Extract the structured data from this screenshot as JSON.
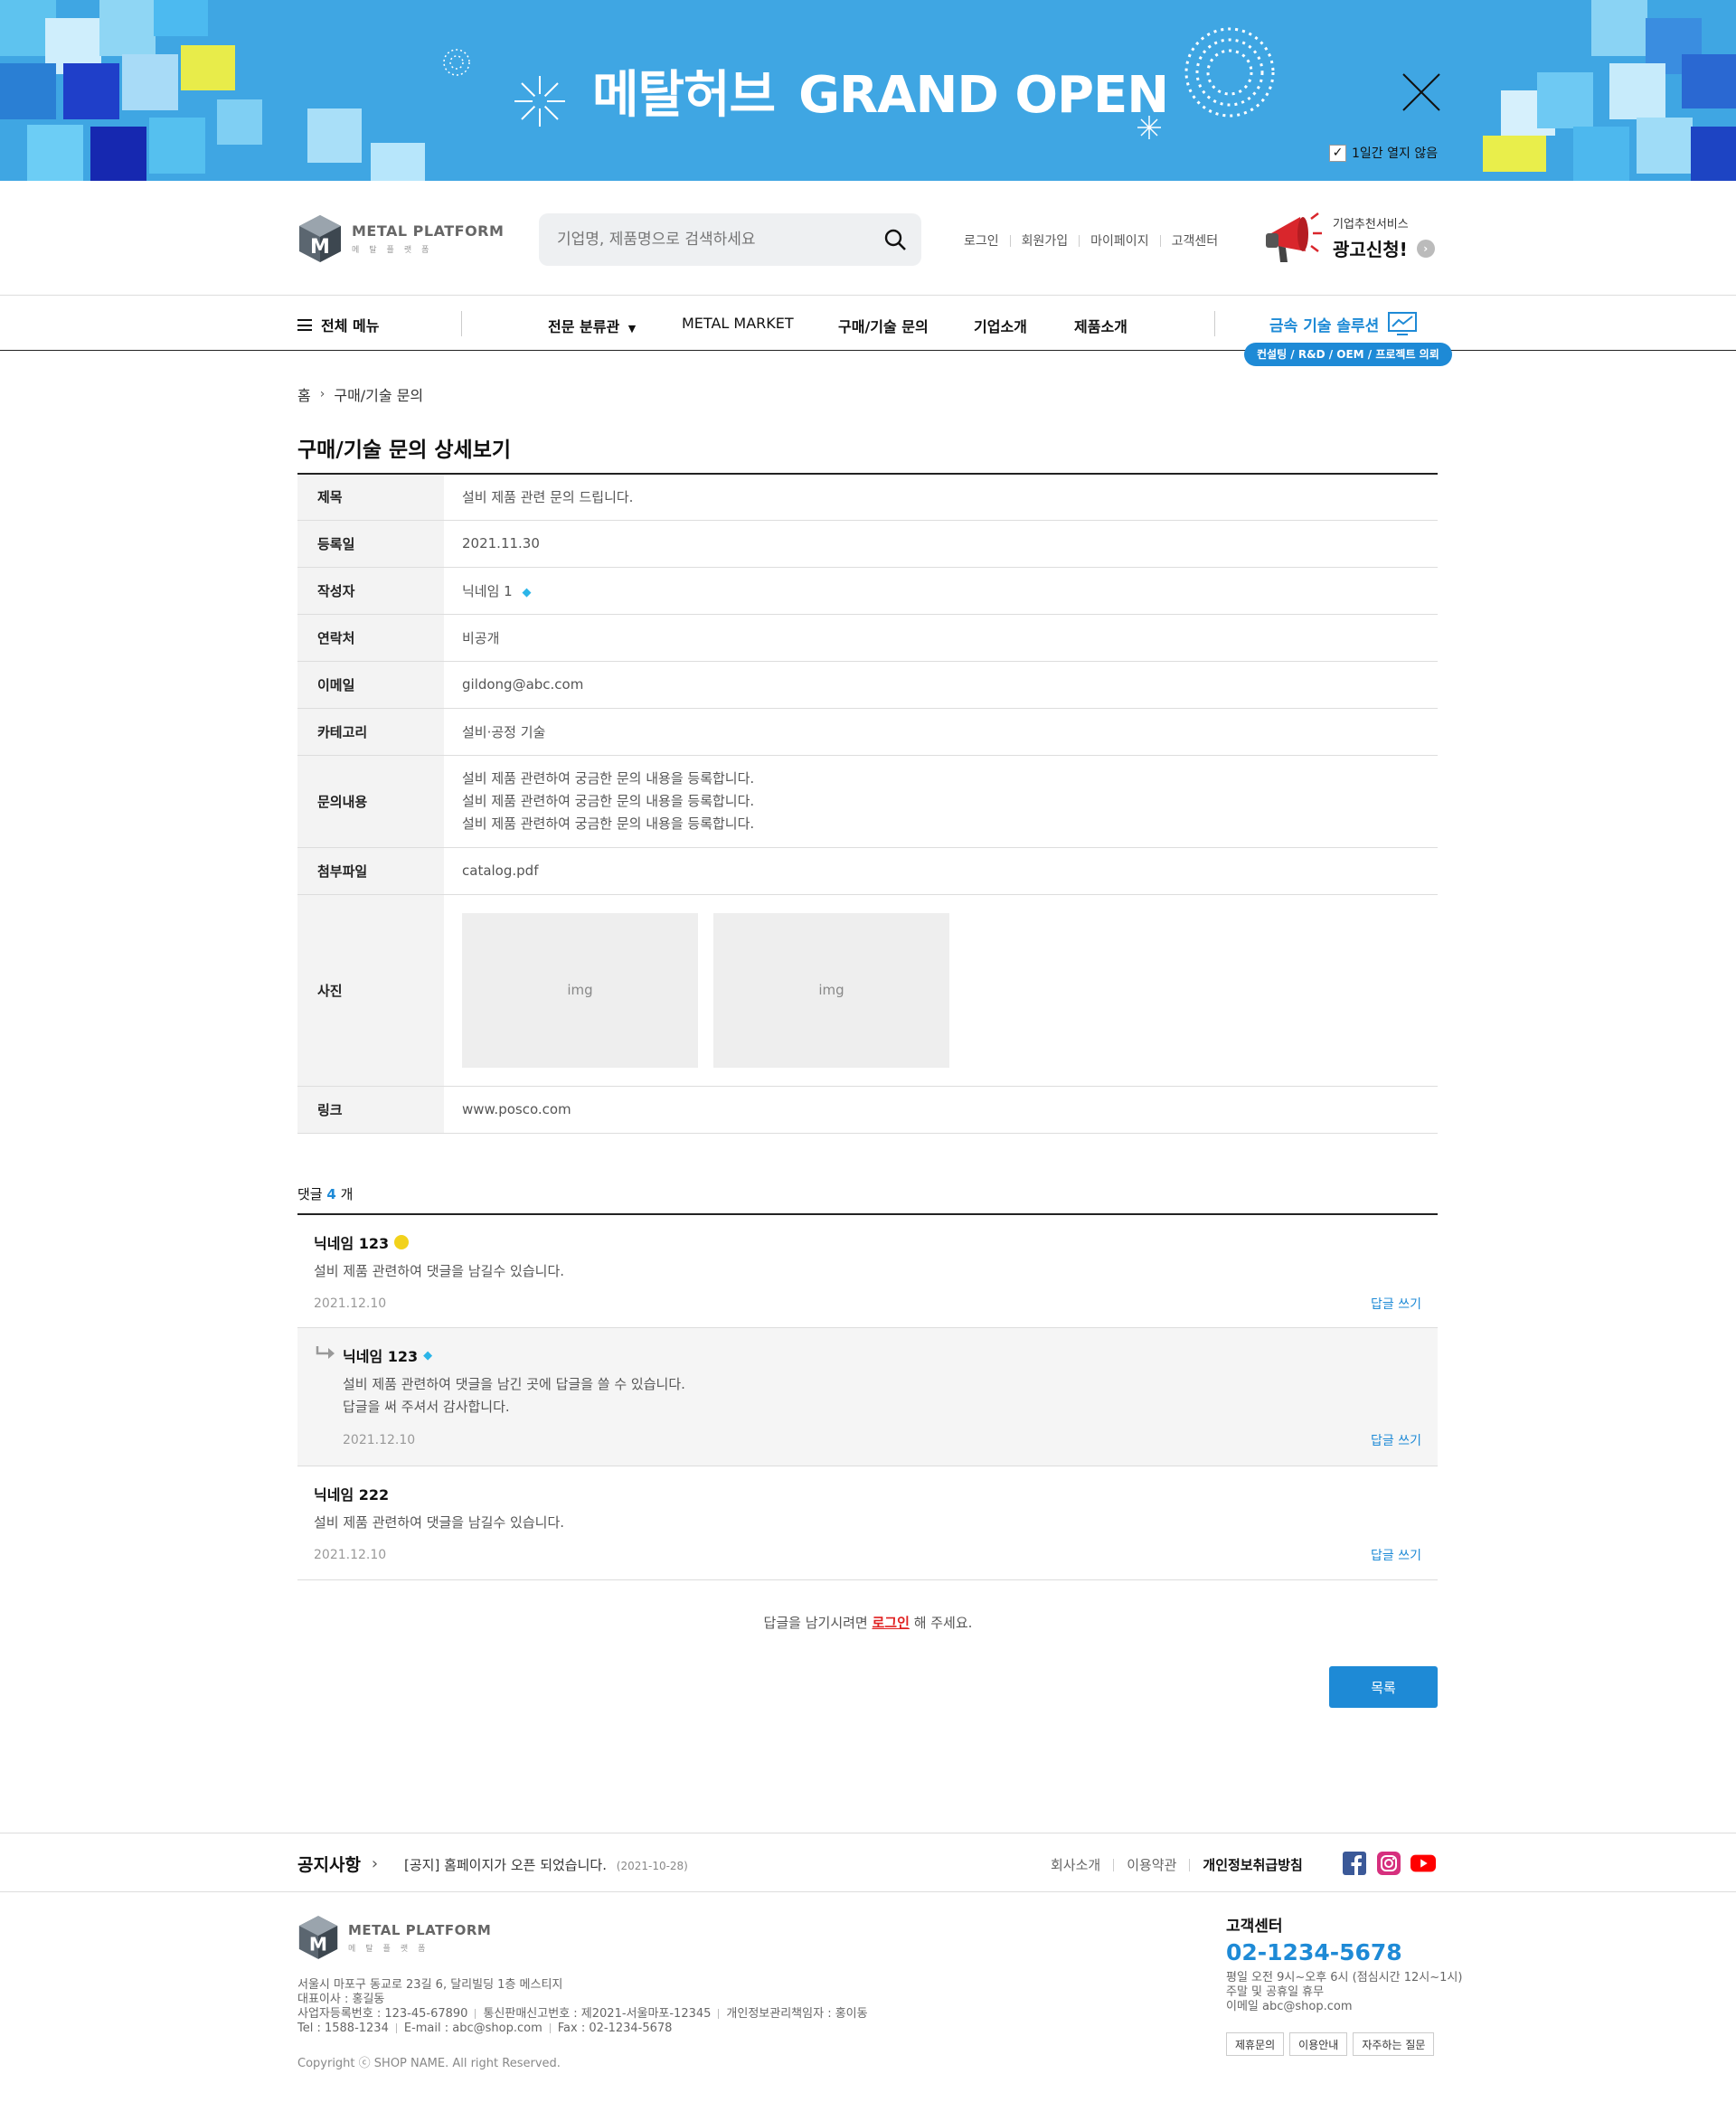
{
  "banner": {
    "title_kr": "메탈허브",
    "title_en": "GRAND OPEN",
    "noshow_label": "1일간 열지 않음"
  },
  "header": {
    "logo_main": "METAL PLATFORM",
    "logo_sub": "메탈플랫폼",
    "search_placeholder": "기업명, 제품명으로 검색하세요",
    "top_links": [
      "로그인",
      "회원가입",
      "마이페이지",
      "고객센터"
    ],
    "ad_small": "기업추천서비스",
    "ad_big": "광고신청!"
  },
  "nav": {
    "all_menu": "전체 메뉴",
    "items": [
      "전문 분류관",
      "METAL MARKET",
      "구매/기술 문의",
      "기업소개",
      "제품소개"
    ],
    "solution": "금속 기술 솔루션",
    "badge": "컨설팅 / R&D / OEM / 프로젝트 의뢰"
  },
  "breadcrumb": {
    "home": "홈",
    "current": "구매/기술 문의"
  },
  "page_title": "구매/기술 문의 상세보기",
  "detail": {
    "subject_label": "제목",
    "subject": "설비 제품 관련 문의 드립니다.",
    "date_label": "등록일",
    "date": "2021.11.30",
    "author_label": "작성자",
    "author": "닉네임 1",
    "contact_label": "연락처",
    "contact": "비공개",
    "email_label": "이메일",
    "email": "gildong@abc.com",
    "category_label": "카테고리",
    "category": "설비·공정 기술",
    "content_label": "문의내용",
    "content": [
      "설비 제품 관련하여 궁금한 문의 내용을 등록합니다.",
      "설비 제품 관련하여 궁금한 문의 내용을 등록합니다.",
      "설비 제품 관련하여 궁금한 문의 내용을 등록합니다."
    ],
    "file_label": "첨부파일",
    "file": "catalog.pdf",
    "photo_label": "사진",
    "photos": [
      "img",
      "img"
    ],
    "link_label": "링크",
    "link": "www.posco.com"
  },
  "comments": {
    "count_prefix": "댓글",
    "count": "4",
    "count_suffix": "개",
    "items": [
      {
        "name": "닉네임 123",
        "body": [
          "설비 제품 관련하여 댓글을 남길수 있습니다."
        ],
        "date": "2021.12.10",
        "reply": "답글 쓰기"
      },
      {
        "name": "닉네임 123",
        "body": [
          "설비 제품 관련하여 댓글을 남긴 곳에 답글을 쓸 수 있습니다.",
          "답글을 써 주셔서 감사합니다."
        ],
        "date": "2021.12.10",
        "reply": "답글 쓰기"
      },
      {
        "name": "닉네임 222",
        "body": [
          "설비 제품 관련하여 댓글을 남길수 있습니다."
        ],
        "date": "2021.12.10",
        "reply": "답글 쓰기"
      }
    ],
    "login_prefix": "답글을 남기시려면",
    "login_link": "로그인",
    "login_suffix": "해 주세요."
  },
  "list_button": "목록",
  "footer": {
    "notice_label": "공지사항",
    "notice_text": "[공지] 홈페이지가 오픈 되었습니다.",
    "notice_date": "(2021-10-28)",
    "links": [
      "회사소개",
      "이용약관",
      "개인정보취급방침"
    ],
    "address": "서울시 마포구 동교로 23길 6, 달리빌딩 1층 메스티지",
    "ceo": "대표이사 : 홍길동",
    "biz_no": "사업자등록번호 : 123-45-67890",
    "mail_order": "통신판매신고번호 : 제2021-서울마포-12345",
    "privacy_officer": "개인정보관리책임자 : 홍이동",
    "tel": "Tel : 1588-1234",
    "email": "E-mail : abc@shop.com",
    "fax": "Fax : 02-1234-5678",
    "copyright": "Copyright ⓒ SHOP NAME. All right Reserved.",
    "cs_title": "고객센터",
    "cs_phone": "02-1234-5678",
    "cs_hours": [
      "평일 오전 9시~오후 6시 (점심시간 12시~1시)",
      "주말 및 공휴일 휴무",
      "이메일 abc@shop.com"
    ],
    "cs_buttons": [
      "제휴문의",
      "이용안내",
      "자주하는 질문"
    ]
  },
  "colors": {
    "accent": "#1e8ad6",
    "banner_bg": "#3fa6e3",
    "login_red": "#e02020"
  }
}
